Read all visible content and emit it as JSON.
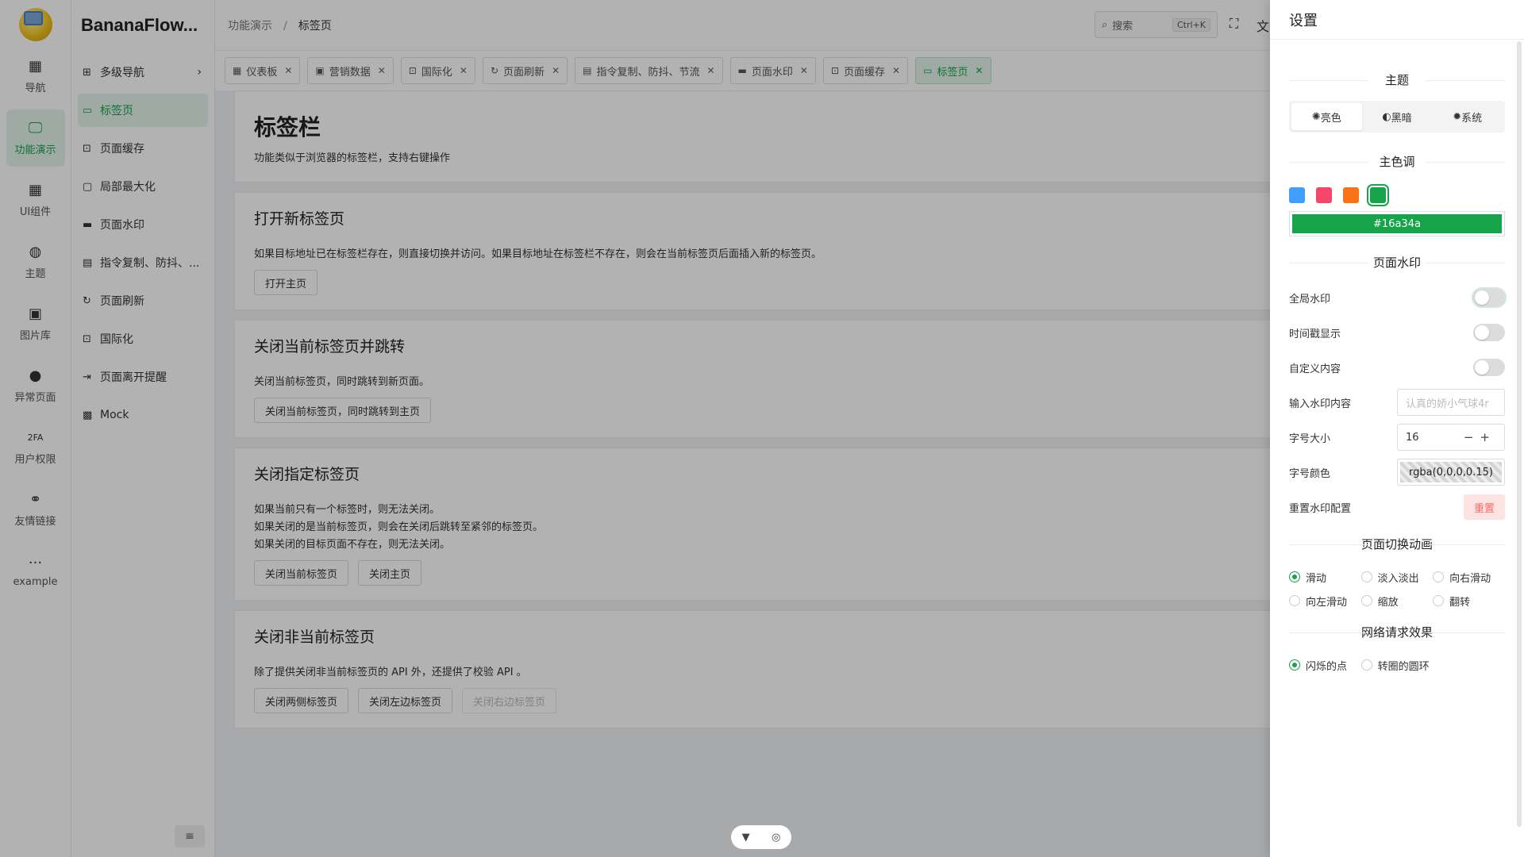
{
  "app": {
    "name": "BananaFlow..."
  },
  "rail": [
    {
      "label": "导航",
      "icon": "grid-icon",
      "glyph": "▦"
    },
    {
      "label": "功能演示",
      "icon": "monitor-icon",
      "glyph": "🖵",
      "active": true
    },
    {
      "label": "UI组件",
      "icon": "blocks-icon",
      "glyph": "▦"
    },
    {
      "label": "主题",
      "icon": "palette-icon",
      "glyph": "◍"
    },
    {
      "label": "图片库",
      "icon": "image-icon",
      "glyph": "▣"
    },
    {
      "label": "异常页面",
      "icon": "alert-icon",
      "glyph": "●"
    },
    {
      "label": "用户权限",
      "icon": "2fa-icon",
      "glyph": "2FA"
    },
    {
      "label": "友情链接",
      "icon": "link-icon",
      "glyph": "⚭"
    },
    {
      "label": "example",
      "icon": "more-icon",
      "glyph": "···"
    }
  ],
  "submenu": [
    {
      "label": "多级导航",
      "icon": "sitemap-icon",
      "glyph": "⊞",
      "chevron": "›"
    },
    {
      "label": "标签页",
      "icon": "tab-icon",
      "glyph": "▭",
      "active": true
    },
    {
      "label": "页面缓存",
      "icon": "cache-icon",
      "glyph": "⊡"
    },
    {
      "label": "局部最大化",
      "icon": "maximize-icon",
      "glyph": "▢"
    },
    {
      "label": "页面水印",
      "icon": "watermark-icon",
      "glyph": "▬"
    },
    {
      "label": "指令复制、防抖、...",
      "icon": "copy-icon",
      "glyph": "▤"
    },
    {
      "label": "页面刷新",
      "icon": "refresh-icon",
      "glyph": "↻"
    },
    {
      "label": "国际化",
      "icon": "globe-icon",
      "glyph": "⊡"
    },
    {
      "label": "页面离开提醒",
      "icon": "exit-icon",
      "glyph": "⇥"
    },
    {
      "label": "Mock",
      "icon": "qr-icon",
      "glyph": "▩"
    }
  ],
  "header": {
    "breadcrumb": [
      "功能演示",
      "标签页"
    ],
    "search_label": "搜索",
    "search_shortcut": "Ctrl+K"
  },
  "tabs": [
    {
      "label": "仪表板",
      "glyph": "▦"
    },
    {
      "label": "营销数据",
      "glyph": "▣"
    },
    {
      "label": "国际化",
      "glyph": "⊡"
    },
    {
      "label": "页面刷新",
      "glyph": "↻"
    },
    {
      "label": "指令复制、防抖、节流",
      "glyph": "▤"
    },
    {
      "label": "页面水印",
      "glyph": "▬"
    },
    {
      "label": "页面缓存",
      "glyph": "⊡"
    },
    {
      "label": "标签页",
      "glyph": "▭",
      "active": true
    }
  ],
  "page": {
    "title": "标签栏",
    "subtitle": "功能类似于浏览器的标签栏，支持右键操作"
  },
  "sections": [
    {
      "title": "打开新标签页",
      "lines": [
        "如果目标地址已在标签栏存在，则直接切换并访问。如果目标地址在标签栏不存在，则会在当前标签页后面插入新的标签页。"
      ],
      "buttons": [
        {
          "label": "打开主页"
        }
      ]
    },
    {
      "title": "关闭当前标签页并跳转",
      "lines": [
        "关闭当前标签页，同时跳转到新页面。"
      ],
      "buttons": [
        {
          "label": "关闭当前标签页，同时跳转到主页"
        }
      ]
    },
    {
      "title": "关闭指定标签页",
      "lines": [
        "如果当前只有一个标签时，则无法关闭。",
        "如果关闭的是当前标签页，则会在关闭后跳转至紧邻的标签页。",
        "如果关闭的目标页面不存在，则无法关闭。"
      ],
      "buttons": [
        {
          "label": "关闭当前标签页"
        },
        {
          "label": "关闭主页"
        }
      ]
    },
    {
      "title": "关闭非当前标签页",
      "lines": [
        "除了提供关闭非当前标签页的 API 外，还提供了校验 API 。"
      ],
      "buttons": [
        {
          "label": "关闭两侧标签页"
        },
        {
          "label": "关闭左边标签页"
        },
        {
          "label": "关闭右边标签页",
          "disabled": true
        }
      ]
    }
  ],
  "settings": {
    "title": "设置",
    "theme": {
      "heading": "主题",
      "modes": [
        "亮色",
        "黑暗",
        "系统"
      ],
      "selected": "亮色"
    },
    "primary": {
      "heading": "主色调",
      "swatches": [
        "#409eff",
        "#f5476a",
        "#f97316",
        "#16a34a"
      ],
      "selected": "#16a34a",
      "value": "#16a34a"
    },
    "watermark": {
      "heading": "页面水印",
      "global_label": "全局水印",
      "timestamp_label": "时间戳显示",
      "custom_label": "自定义内容",
      "content_label": "输入水印内容",
      "content_placeholder": "认真的娇小气球4r",
      "size_label": "字号大小",
      "size_value": "16",
      "color_label": "字号颜色",
      "color_value": "rgba(0,0,0,0.15)",
      "reset_label": "重置水印配置",
      "reset_button": "重置"
    },
    "transition": {
      "heading": "页面切换动画",
      "options": [
        "滑动",
        "淡入淡出",
        "向右滑动",
        "向左滑动",
        "缩放",
        "翻转"
      ],
      "selected": "滑动"
    },
    "loading": {
      "heading": "网络请求效果",
      "options": [
        "闪烁的点",
        "转圈的圆环"
      ],
      "selected": "闪烁的点"
    }
  }
}
